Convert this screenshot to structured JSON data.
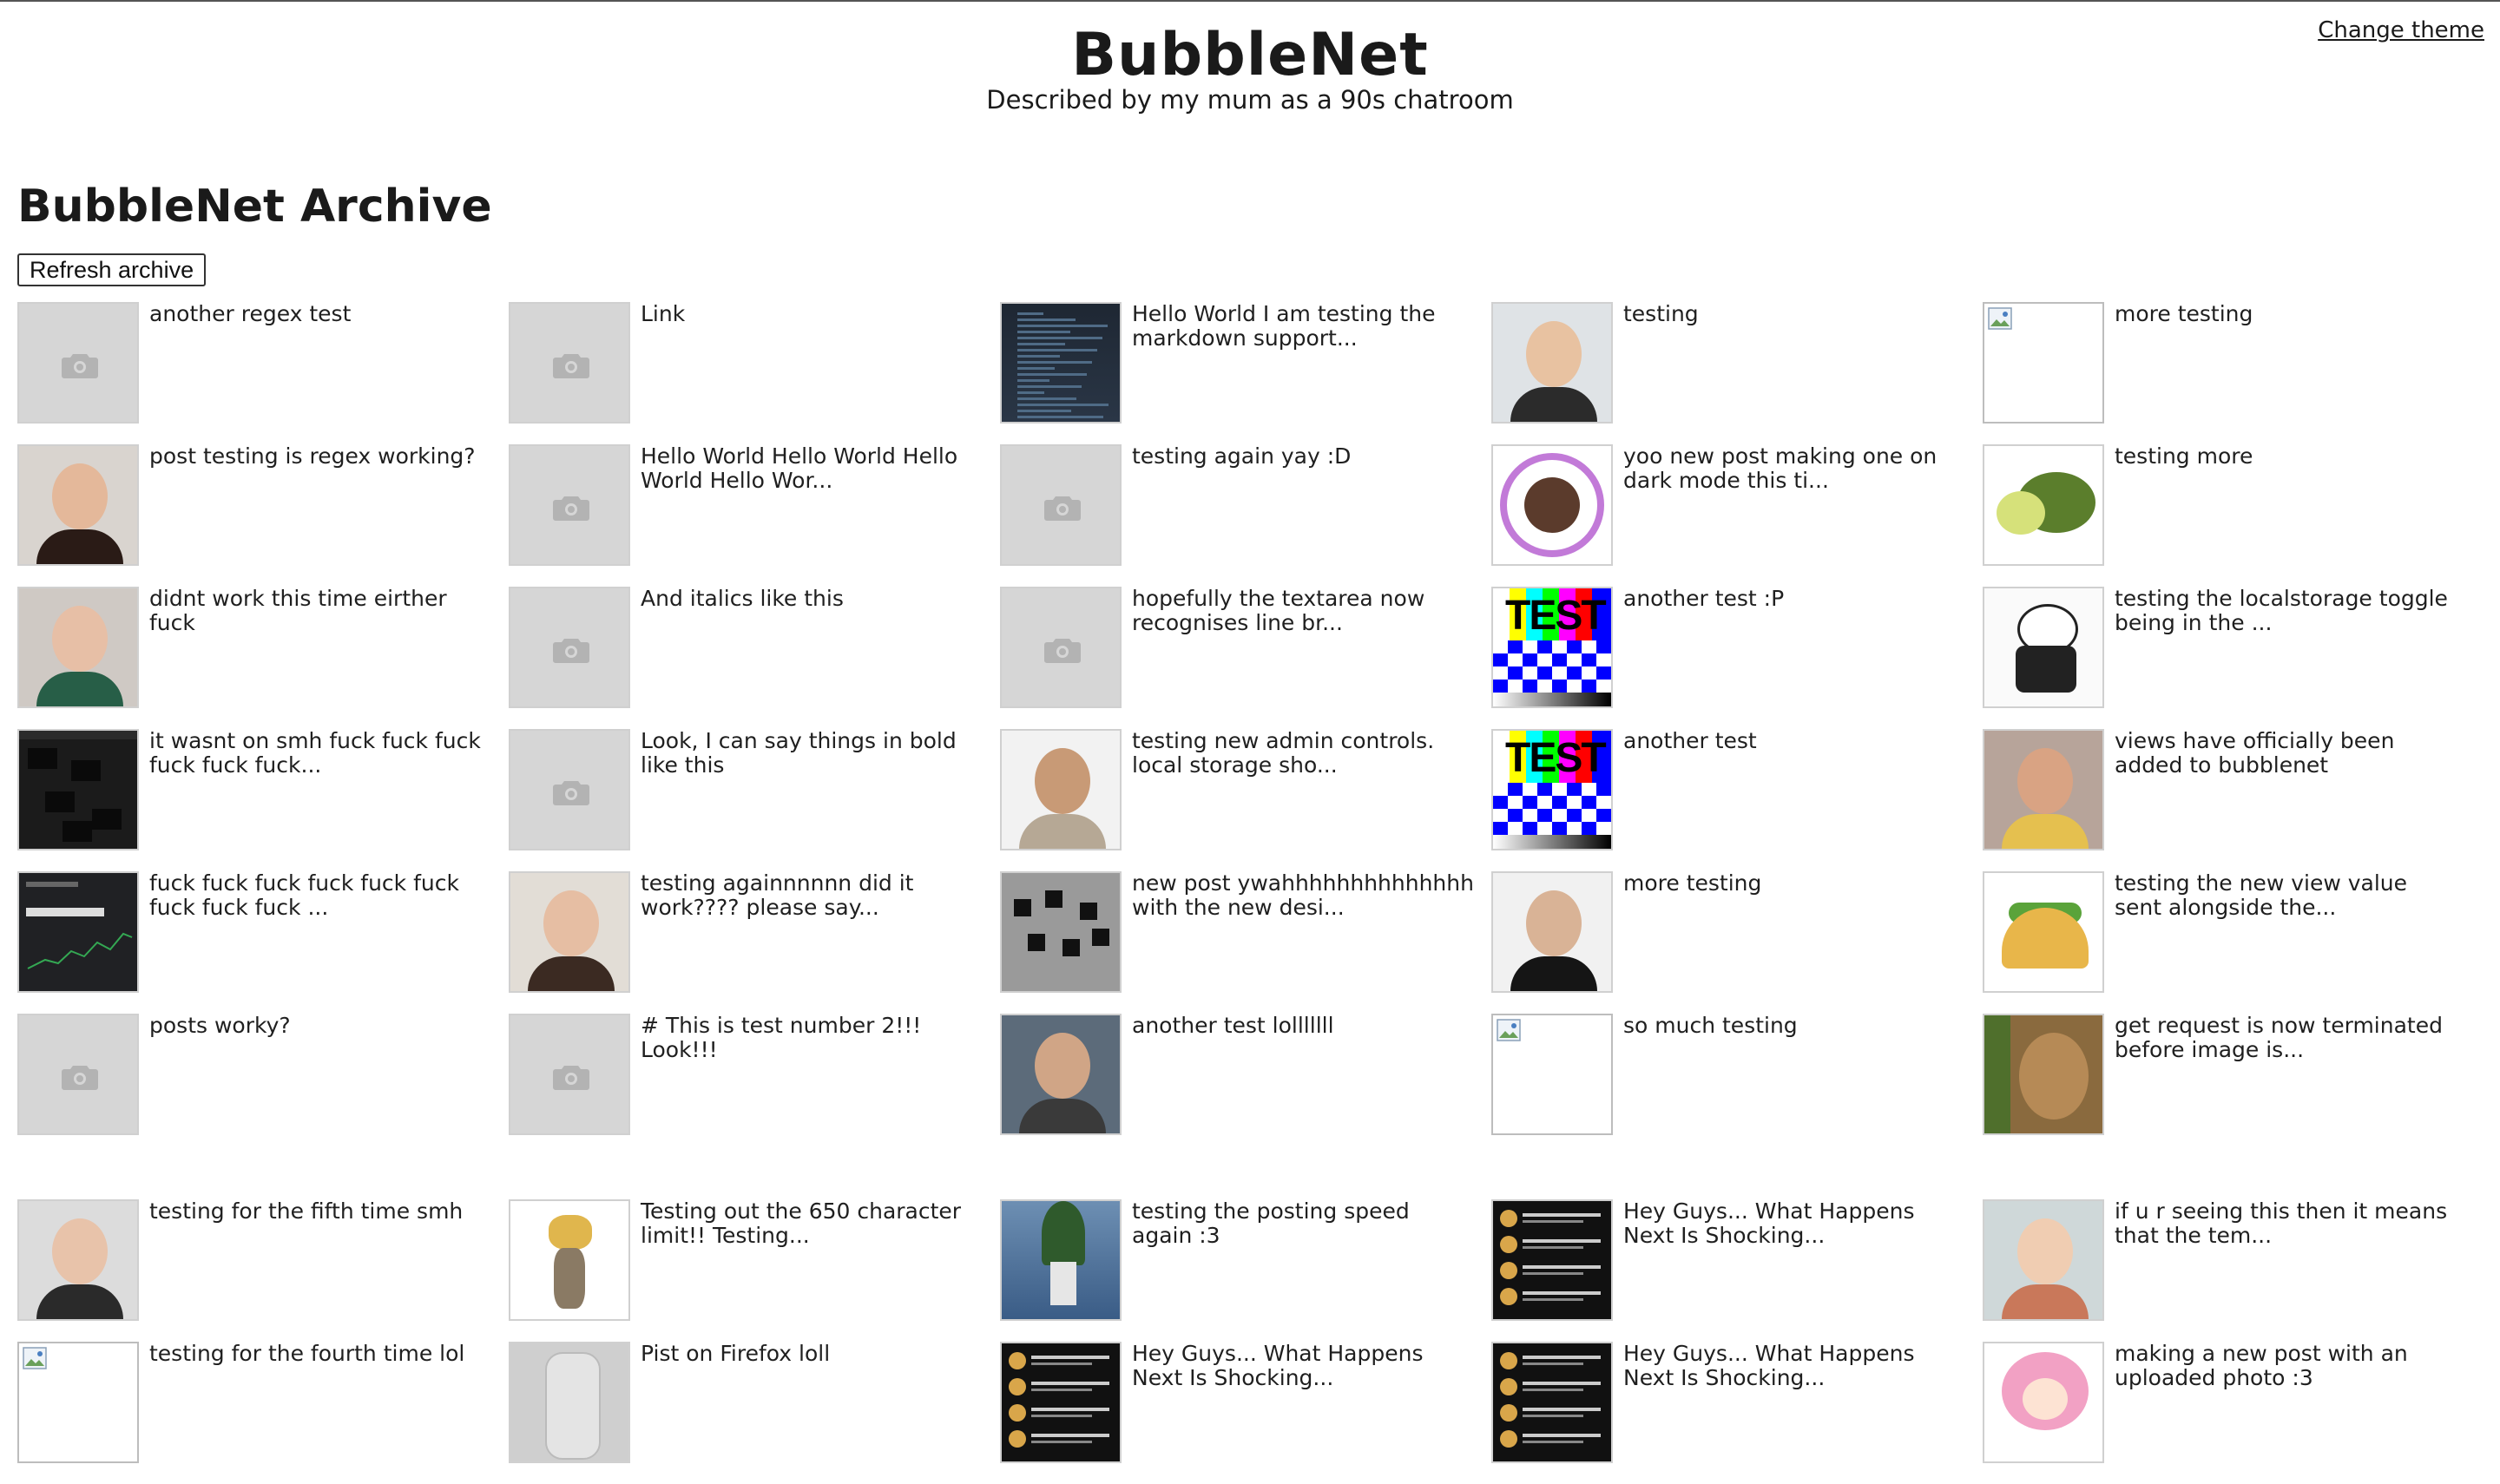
{
  "header": {
    "title": "BubbleNet",
    "subtitle": "Described by my mum as a 90s chatroom",
    "theme_link": "Change theme"
  },
  "archive": {
    "title": "BubbleNet Archive",
    "refresh_label": "Refresh archive"
  },
  "posts": [
    {
      "text": "another regex test",
      "thumb": "placeholder"
    },
    {
      "text": "Link",
      "thumb": "placeholder"
    },
    {
      "text": "Hello World I am testing the markdown support...",
      "thumb": "code-screenshot"
    },
    {
      "text": "testing",
      "thumb": "man-on-phone"
    },
    {
      "text": "more testing",
      "thumb": "broken-image"
    },
    {
      "text": "post testing is regex working?",
      "thumb": "portrait"
    },
    {
      "text": "Hello World Hello World Hello World Hello Wor...",
      "thumb": "placeholder"
    },
    {
      "text": "testing again yay :D",
      "thumb": "placeholder"
    },
    {
      "text": "yoo new post making one on dark mode this ti...",
      "thumb": "ashley-approved-badge"
    },
    {
      "text": "testing more",
      "thumb": "cat-turtle"
    },
    {
      "text": "didnt work this time eirther fuck",
      "thumb": "green-hair-portrait"
    },
    {
      "text": "And italics like this",
      "thumb": "placeholder"
    },
    {
      "text": "hopefully the textarea now recognises line br...",
      "thumb": "placeholder"
    },
    {
      "text": "another test :P",
      "thumb": "test-pattern"
    },
    {
      "text": "testing the localstorage toggle being in the ...",
      "thumb": "cat-sketch"
    },
    {
      "text": "it wasnt on smh fuck fuck fuck fuck fuck fuck...",
      "thumb": "dark-screenshot"
    },
    {
      "text": "Look, I can say things in bold like this",
      "thumb": "placeholder"
    },
    {
      "text": "testing new admin controls. local storage sho...",
      "thumb": "guy-standing"
    },
    {
      "text": "another test",
      "thumb": "test-pattern"
    },
    {
      "text": "views have officially been added to bubblenet",
      "thumb": "mirror-selfie"
    },
    {
      "text": "fuck fuck fuck fuck fuck fuck fuck fuck fuck ...",
      "thumb": "stock-chart"
    },
    {
      "text": "testing againnnnnn did it work???? please say...",
      "thumb": "shush-portrait"
    },
    {
      "text": "new post ywahhhhhhhhhhhhhh with the new desi...",
      "thumb": "cards-on-table"
    },
    {
      "text": "more testing",
      "thumb": "sleeping-man"
    },
    {
      "text": "testing the new view value sent alongside the...",
      "thumb": "taco"
    },
    {
      "text": "posts worky?",
      "thumb": "placeholder"
    },
    {
      "text": "# This is test number 2!!! Look!!!",
      "thumb": "placeholder"
    },
    {
      "text": "another test lolllllll",
      "thumb": "beanie-person"
    },
    {
      "text": "so much testing",
      "thumb": "broken-image"
    },
    {
      "text": "get request is now terminated before image is...",
      "thumb": "cat-closeup"
    },
    {
      "text": "testing for the fifth time smh",
      "thumb": "selfie-phone"
    },
    {
      "text": "Testing out the 650 character limit!! Testing...",
      "thumb": "cat-bread"
    },
    {
      "text": "testing the posting speed again :3",
      "thumb": "plant"
    },
    {
      "text": "Hey Guys... What Happens Next Is Shocking...",
      "thumb": "spotify-chat"
    },
    {
      "text": "if u r seeing this then it means that the tem...",
      "thumb": "glasses-portrait"
    },
    {
      "text": "testing for the fourth time lol",
      "thumb": "broken-image"
    },
    {
      "text": "Pist on Firefox loll",
      "thumb": "bottle"
    },
    {
      "text": "Hey Guys... What Happens Next Is Shocking...",
      "thumb": "spotify-chat"
    },
    {
      "text": "Hey Guys... What Happens Next Is Shocking...",
      "thumb": "spotify-chat"
    },
    {
      "text": "making a new post with an uploaded photo :3",
      "thumb": "anime-girl"
    }
  ],
  "spotify_chat": {
    "line1": "baked bean ...",
    "line2": "Listening to Spotify",
    "line3": "Boombaclat",
    "line4": "GET OUT"
  },
  "test_pattern_word": "TEST",
  "colors": {
    "background": "#ffffff",
    "text": "#1a1a1a",
    "placeholder": "#d6d6d6"
  }
}
